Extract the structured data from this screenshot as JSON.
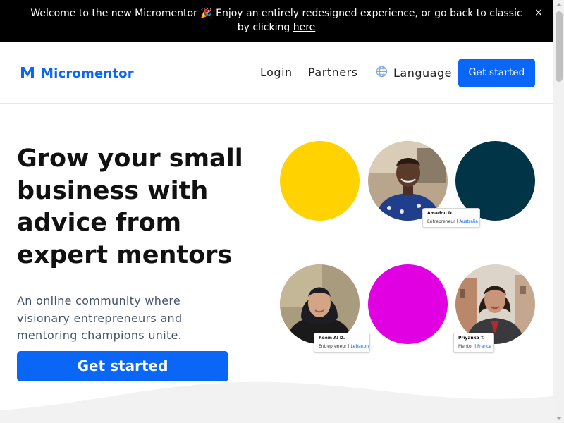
{
  "announcement": {
    "text": "Welcome to the new Micromentor 🎉 Enjoy an entirely redesigned experience, or go back to classic by clicking",
    "link_text": "here",
    "close_label": "×"
  },
  "header": {
    "logo_text": "Micromentor",
    "nav": {
      "login": "Login",
      "partners": "Partners",
      "language": "Language"
    },
    "cta": "Get started"
  },
  "hero": {
    "title": "Grow your small business with advice from expert mentors",
    "subtitle": "An online community where visionary entrepreneurs and mentoring champions unite.",
    "cta": "Get started"
  },
  "profiles": [
    {
      "name": "Amadou D.",
      "role": "Entrepreneur",
      "location": "Australia"
    },
    {
      "name": "Reem Al D.",
      "role": "Entrepreneur",
      "location": "Lebanon"
    },
    {
      "name": "Priyanka T.",
      "role": "Mentor",
      "location": "France"
    }
  ],
  "colors": {
    "brand_blue": "#0a66f6",
    "circle_yellow": "#ffd200",
    "circle_navy": "#023447",
    "circle_magenta": "#e100e1"
  },
  "icons": {
    "logo": "micromentor-logo-icon",
    "language": "globe-icon",
    "close": "close-icon"
  }
}
